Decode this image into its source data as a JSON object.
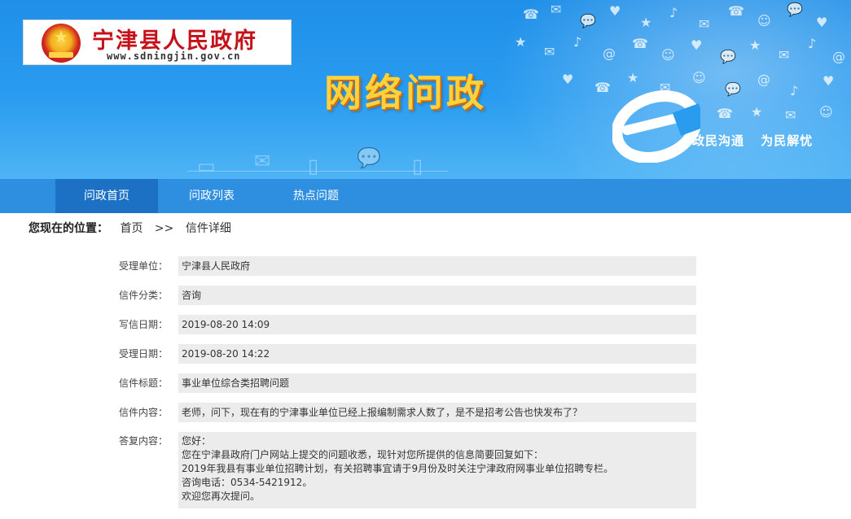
{
  "header": {
    "site_name": "宁津县人民政府",
    "site_url": "www.sdningjin.gov.cn",
    "section_title": "网络问政",
    "slogan": [
      "政民沟通",
      "为民解忧"
    ]
  },
  "nav": {
    "tabs": [
      {
        "label": "问政首页",
        "active": true
      },
      {
        "label": "问政列表",
        "active": false
      },
      {
        "label": "热点问题",
        "active": false
      }
    ]
  },
  "breadcrumb": {
    "label": "您现在的位置：",
    "home": "首页",
    "separator": ">>",
    "current": "信件详细"
  },
  "letter": {
    "fields": [
      {
        "key": "受理单位：",
        "value": "宁津县人民政府"
      },
      {
        "key": "信件分类：",
        "value": "咨询"
      },
      {
        "key": "写信日期：",
        "value": "2019-08-20 14:09"
      },
      {
        "key": "受理日期：",
        "value": "2019-08-20 14:22"
      },
      {
        "key": "信件标题：",
        "value": "事业单位综合类招聘问题"
      },
      {
        "key": "信件内容：",
        "value": "老师，问下，现在有的宁津事业单位已经上报编制需求人数了，是不是招考公告也快发布了？"
      }
    ],
    "reply": {
      "key": "答复内容：",
      "lines": [
        "您好：",
        "您在宁津县政府门户网站上提交的问题收悉，现针对您所提供的信息简要回复如下：",
        "2019年我县有事业单位招聘计划，有关招聘事宜请于9月份及时关注宁津政府网事业单位招聘专栏。",
        "咨询电话：0534-5421912。",
        "欢迎您再次提问。"
      ]
    }
  },
  "colors": {
    "banner_top": "#1f8fe8",
    "nav_bg": "#2e8fe0",
    "nav_active": "#1d71c4",
    "title_yellow": "#ffd23c",
    "site_name_red": "#c5121a",
    "field_bg": "#ececec"
  }
}
